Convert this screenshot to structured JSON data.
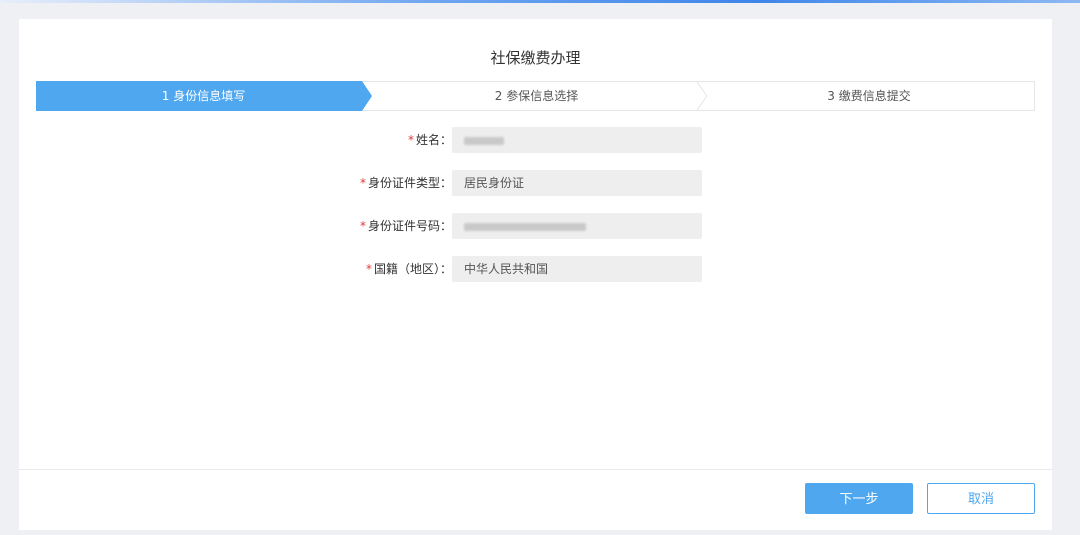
{
  "page": {
    "title": "社保缴费办理"
  },
  "steps": [
    {
      "label": "1 身份信息填写",
      "active": true
    },
    {
      "label": "2 参保信息选择",
      "active": false
    },
    {
      "label": "3 缴费信息提交",
      "active": false
    }
  ],
  "form": {
    "required_mark": "*",
    "name_label": "姓名：",
    "name_value": "",
    "id_type_label": "身份证件类型：",
    "id_type_value": "居民身份证",
    "id_number_label": "身份证件号码：",
    "id_number_value": "",
    "nationality_label": "国籍（地区）：",
    "nationality_value": "中华人民共和国"
  },
  "footer": {
    "next_label": "下一步",
    "cancel_label": "取消"
  },
  "colors": {
    "accent": "#4fa7f0",
    "required": "#e03a3a",
    "field_bg": "#eeeeee"
  }
}
